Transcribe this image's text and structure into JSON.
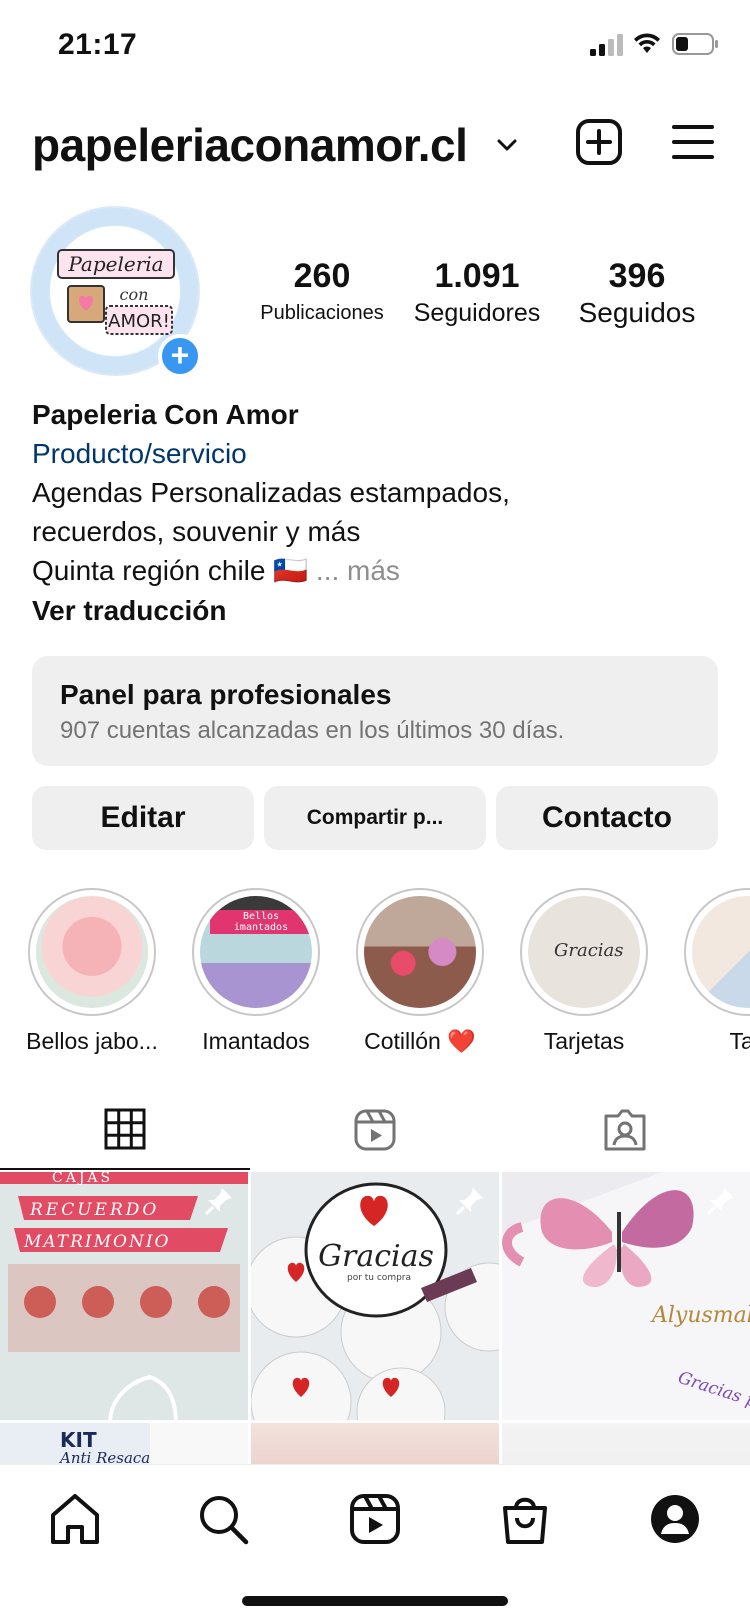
{
  "status": {
    "time": "21:17"
  },
  "header": {
    "username": "papeleriaconamor.cl"
  },
  "profile": {
    "avatar_text": [
      "Papeleria",
      "con",
      "AMOR!"
    ],
    "stats": [
      {
        "value": "260",
        "label": "Publicaciones"
      },
      {
        "value": "1.091",
        "label": "Seguidores"
      },
      {
        "value": "396",
        "label": "Seguidos"
      }
    ],
    "name": "Papeleria Con Amor",
    "category": "Producto/servicio",
    "bio_line1": "Agendas Personalizadas estampados,",
    "bio_line2": "recuerdos, souvenir y más",
    "bio_line3": "Quinta región chile",
    "flag": "🇨🇱",
    "more": "... más",
    "translate": "Ver traducción"
  },
  "panel": {
    "title": "Panel para profesionales",
    "subtitle": "907 cuentas alcanzadas en los últimos 30 días."
  },
  "buttons": {
    "edit": "Editar",
    "share": "Compartir p...",
    "contact": "Contacto"
  },
  "highlights": [
    {
      "label": "Bellos jabo..."
    },
    {
      "label": "Imantados",
      "thumb_text": "Bellos imantados"
    },
    {
      "label": "Cotillón ❤️"
    },
    {
      "label": "Tarjetas",
      "thumb_text": "Gracias"
    },
    {
      "label": "Tag"
    }
  ],
  "grid": [
    {
      "text1": "CAJAS",
      "text2": "RECUERDO",
      "text3": "MATRIMONIO"
    },
    {
      "text1": "Gracias",
      "text2": "por tu compra"
    },
    {
      "text1": "Alyusmal",
      "text2": "Gracias por tu compra"
    },
    {
      "text1": "KIT",
      "text2": "Anti Resaca"
    }
  ],
  "colors": {
    "accent": "#3897f0",
    "link": "#00376b",
    "muted": "#737373",
    "panel": "#efefef"
  }
}
